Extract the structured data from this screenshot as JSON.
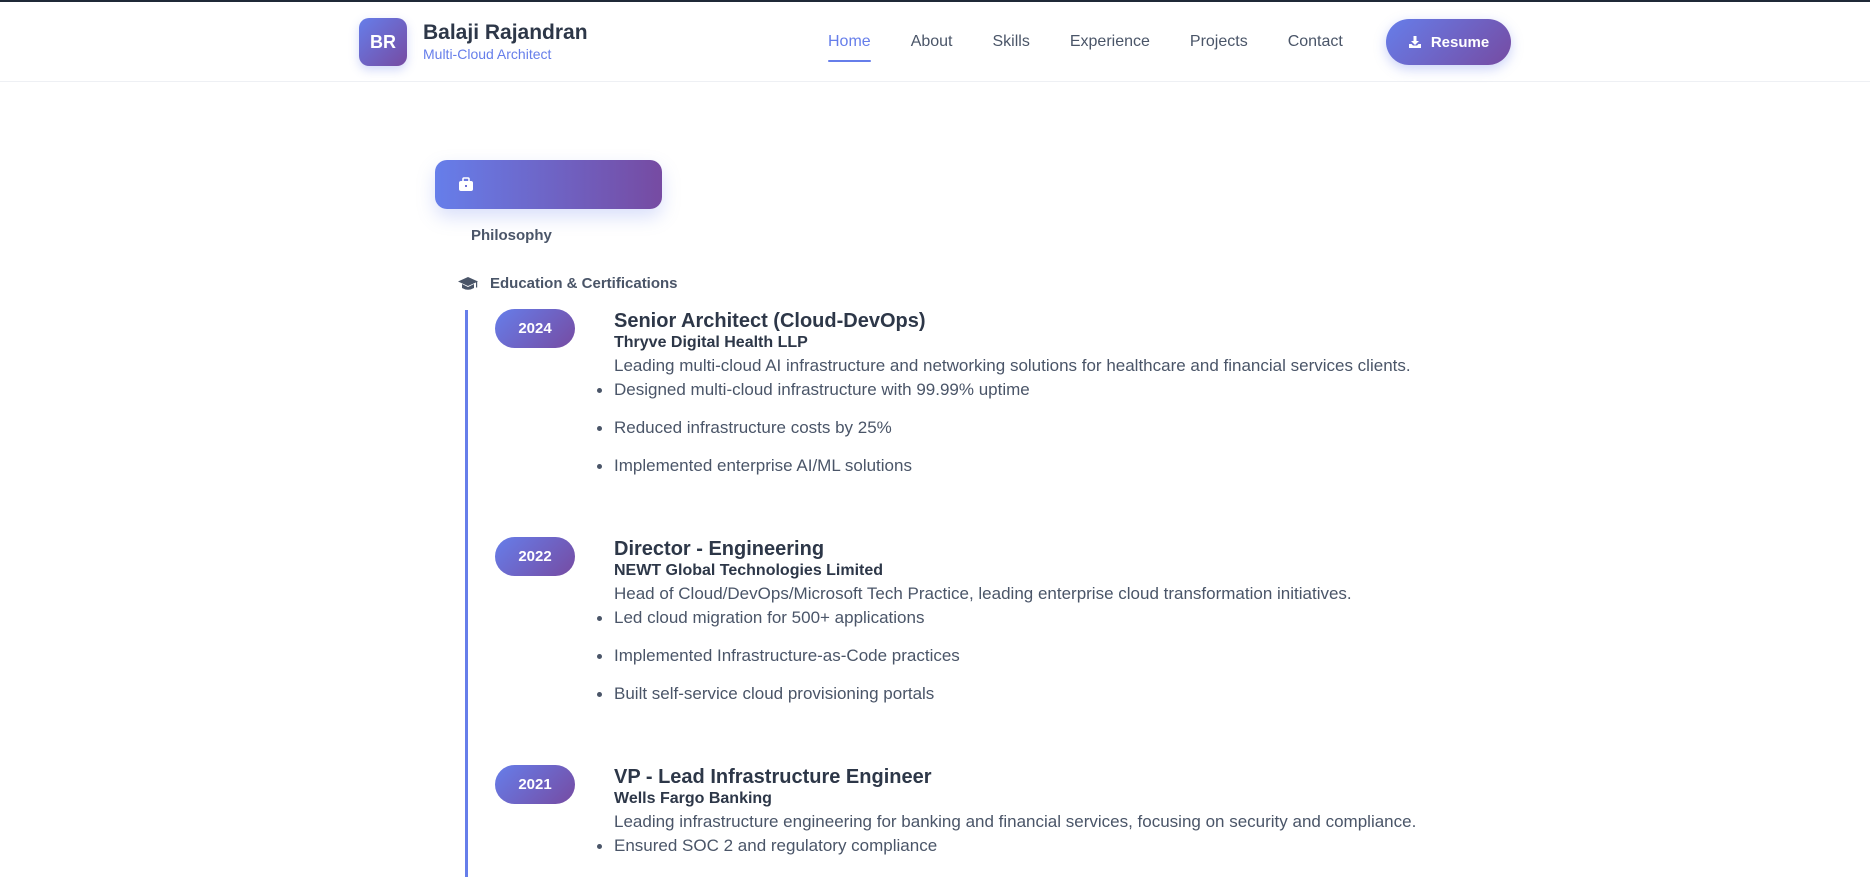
{
  "brand": {
    "initials": "BR",
    "name": "Balaji Rajandran",
    "subtitle": "Multi-Cloud Architect"
  },
  "nav": {
    "items": [
      "Home",
      "About",
      "Skills",
      "Experience",
      "Projects",
      "Contact"
    ],
    "active": "Home"
  },
  "resume_button": {
    "label": "Resume",
    "icon": "download-icon"
  },
  "tabs": {
    "active_icon": "briefcase-icon",
    "philosophy": "Philosophy",
    "education": {
      "icon": "graduation-cap-icon",
      "label": "Education & Certifications"
    }
  },
  "timeline": [
    {
      "year": "2024",
      "role": "Senior Architect (Cloud-DevOps)",
      "company": "Thryve Digital Health LLP",
      "description": "Leading multi-cloud AI infrastructure and networking solutions for healthcare and financial services clients.",
      "points": [
        "Designed multi-cloud infrastructure with 99.99% uptime",
        "Reduced infrastructure costs by 25%",
        "Implemented enterprise AI/ML solutions"
      ]
    },
    {
      "year": "2022",
      "role": "Director - Engineering",
      "company": "NEWT Global Technologies Limited",
      "description": "Head of Cloud/DevOps/Microsoft Tech Practice, leading enterprise cloud transformation initiatives.",
      "points": [
        "Led cloud migration for 500+ applications",
        "Implemented Infrastructure-as-Code practices",
        "Built self-service cloud provisioning portals"
      ]
    },
    {
      "year": "2021",
      "role": "VP - Lead Infrastructure Engineer",
      "company": "Wells Fargo Banking",
      "description": "Leading infrastructure engineering for banking and financial services, focusing on security and compliance.",
      "points": [
        "Ensured SOC 2 and regulatory compliance"
      ]
    }
  ]
}
